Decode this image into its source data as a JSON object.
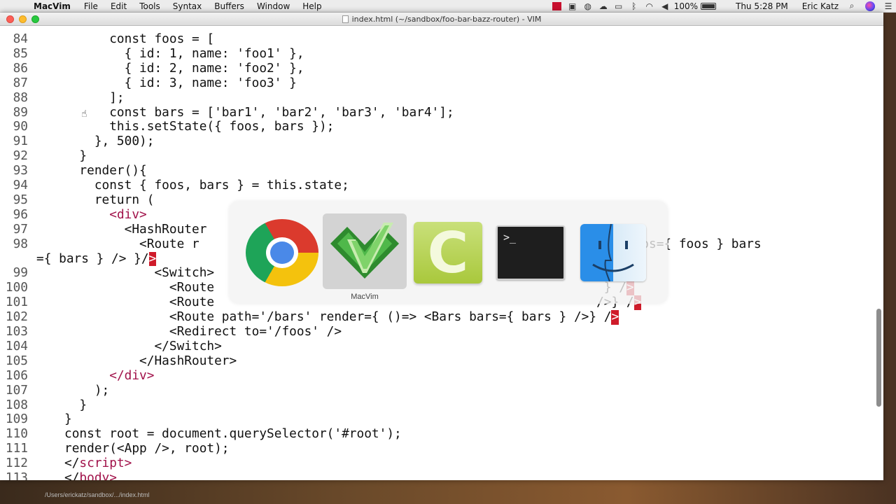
{
  "menubar": {
    "app_name": "MacVim",
    "items": [
      "File",
      "Edit",
      "Tools",
      "Syntax",
      "Buffers",
      "Window",
      "Help"
    ],
    "battery": "100%",
    "clock": "Thu 5:28 PM",
    "user": "Eric Katz"
  },
  "window": {
    "title": "index.html (~/sandbox/foo-bar-bazz-router) - VIM"
  },
  "code_lines": [
    {
      "n": "84",
      "segs": [
        {
          "t": "      const foos = ["
        }
      ]
    },
    {
      "n": "85",
      "segs": [
        {
          "t": "        { id: 1, name: 'foo1' },"
        }
      ]
    },
    {
      "n": "86",
      "segs": [
        {
          "t": "        { id: 2, name: 'foo2' },"
        }
      ]
    },
    {
      "n": "87",
      "segs": [
        {
          "t": "        { id: 3, name: 'foo3' }"
        }
      ]
    },
    {
      "n": "88",
      "segs": [
        {
          "t": "      ];"
        }
      ]
    },
    {
      "n": "89",
      "segs": [
        {
          "t": "      const bars = ['bar1', 'bar2', 'bar3', 'bar4'];"
        }
      ]
    },
    {
      "n": "90",
      "segs": [
        {
          "t": "      this.setState({ foos, bars });"
        }
      ]
    },
    {
      "n": "91",
      "segs": [
        {
          "t": "    }, 500);"
        }
      ]
    },
    {
      "n": "92",
      "segs": [
        {
          "t": "  }"
        }
      ]
    },
    {
      "n": "93",
      "segs": [
        {
          "t": "  render(){"
        }
      ]
    },
    {
      "n": "94",
      "segs": [
        {
          "t": "    const { foos, bars } = this.state;"
        }
      ]
    },
    {
      "n": "95",
      "segs": [
        {
          "t": "    return ("
        }
      ]
    },
    {
      "n": "96",
      "segs": [
        {
          "t": "      "
        },
        {
          "t": "<div>",
          "c": "tag"
        }
      ]
    },
    {
      "n": "97",
      "segs": [
        {
          "t": "        <HashRouter"
        }
      ]
    },
    {
      "n": "98",
      "segs": [
        {
          "t": "          <Route r"
        },
        {
          "t": "                                                   ame } foos={ foos } bars"
        }
      ]
    },
    {
      "n": "",
      "segs": [
        {
          "t": "={ bars } /> }/"
        },
        {
          "t": ">",
          "c": "err"
        }
      ]
    },
    {
      "n": "99",
      "segs": [
        {
          "t": "            <Switch>"
        }
      ]
    },
    {
      "n": "100",
      "segs": [
        {
          "t": "              <Route"
        },
        {
          "t": "                                                    } /"
        },
        {
          "t": ">",
          "c": "err"
        }
      ]
    },
    {
      "n": "101",
      "segs": [
        {
          "t": "              <Route"
        },
        {
          "t": "                                                   />} /"
        },
        {
          "t": ">",
          "c": "err"
        }
      ]
    },
    {
      "n": "102",
      "segs": [
        {
          "t": "              <Route path='/bars' render={ ()=> <Bars bars={ bars } />} /"
        },
        {
          "t": ">",
          "c": "err"
        }
      ]
    },
    {
      "n": "103",
      "segs": [
        {
          "t": "              <Redirect to='/foos' />"
        }
      ]
    },
    {
      "n": "104",
      "segs": [
        {
          "t": "            </Switch>"
        }
      ]
    },
    {
      "n": "105",
      "segs": [
        {
          "t": "          </HashRouter>"
        }
      ]
    },
    {
      "n": "106",
      "segs": [
        {
          "t": "      "
        },
        {
          "t": "</div>",
          "c": "tag"
        }
      ]
    },
    {
      "n": "107",
      "segs": [
        {
          "t": "    );"
        }
      ]
    },
    {
      "n": "108",
      "segs": [
        {
          "t": "  }"
        }
      ]
    },
    {
      "n": "109",
      "segs": [
        {
          "t": "}"
        }
      ]
    },
    {
      "n": "110",
      "segs": [
        {
          "t": "const root = document.querySelector('#root');"
        }
      ]
    },
    {
      "n": "111",
      "segs": [
        {
          "t": "render(<App />, root);"
        }
      ]
    },
    {
      "n": "112",
      "segs": [
        {
          "t": "</"
        },
        {
          "t": "script",
          "c": "tag"
        },
        {
          "t": ">",
          "c": "tag"
        }
      ]
    },
    {
      "n": "113",
      "segs": [
        {
          "t": "</"
        },
        {
          "t": "body",
          "c": "tag"
        },
        {
          "t": ">",
          "c": "tag"
        }
      ]
    }
  ],
  "app_switcher": {
    "apps": [
      {
        "name": "Google Chrome",
        "icon": "chrome-icon"
      },
      {
        "name": "MacVim",
        "icon": "macvim-icon",
        "selected": true
      },
      {
        "name": "Camtasia",
        "icon": "camtasia-icon"
      },
      {
        "name": "Terminal",
        "icon": "terminal-icon"
      },
      {
        "name": "Finder",
        "icon": "finder-icon"
      }
    ],
    "selected_label": "MacVim",
    "terminal_prompt": ">_"
  },
  "status_path": "/Users/erickatz/sandbox/.../index.html",
  "colors": {
    "tag": "#a1124a",
    "error_bg": "#cf1b2a"
  }
}
